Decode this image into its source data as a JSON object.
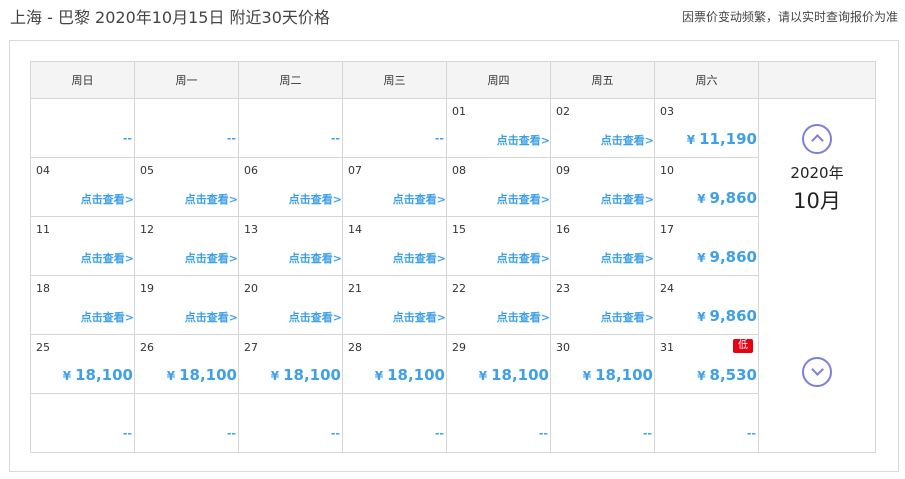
{
  "header": {
    "title": "上海 - 巴黎 2020年10月15日  附近30天价格",
    "notice": "因票价变动频繁，请以实时查询报价为准"
  },
  "weekdays": [
    "周日",
    "周一",
    "周二",
    "周三",
    "周四",
    "周五",
    "周六"
  ],
  "month_nav": {
    "year": "2020年",
    "month": "10月"
  },
  "link_text": "点击查看>",
  "currency": "¥",
  "low_badge": "低",
  "weeks": [
    [
      {
        "empty": true
      },
      {
        "empty": true
      },
      {
        "empty": true
      },
      {
        "empty": true
      },
      {
        "day": "01",
        "type": "link"
      },
      {
        "day": "02",
        "type": "link"
      },
      {
        "day": "03",
        "type": "price",
        "price": "11,190"
      }
    ],
    [
      {
        "day": "04",
        "type": "link"
      },
      {
        "day": "05",
        "type": "link"
      },
      {
        "day": "06",
        "type": "link"
      },
      {
        "day": "07",
        "type": "link"
      },
      {
        "day": "08",
        "type": "link"
      },
      {
        "day": "09",
        "type": "link"
      },
      {
        "day": "10",
        "type": "price",
        "price": "9,860"
      }
    ],
    [
      {
        "day": "11",
        "type": "link"
      },
      {
        "day": "12",
        "type": "link"
      },
      {
        "day": "13",
        "type": "link"
      },
      {
        "day": "14",
        "type": "link"
      },
      {
        "day": "15",
        "type": "link"
      },
      {
        "day": "16",
        "type": "link"
      },
      {
        "day": "17",
        "type": "price",
        "price": "9,860"
      }
    ],
    [
      {
        "day": "18",
        "type": "link"
      },
      {
        "day": "19",
        "type": "link"
      },
      {
        "day": "20",
        "type": "link"
      },
      {
        "day": "21",
        "type": "link"
      },
      {
        "day": "22",
        "type": "link"
      },
      {
        "day": "23",
        "type": "link"
      },
      {
        "day": "24",
        "type": "price",
        "price": "9,860"
      }
    ],
    [
      {
        "day": "25",
        "type": "price",
        "price": "18,100"
      },
      {
        "day": "26",
        "type": "price",
        "price": "18,100"
      },
      {
        "day": "27",
        "type": "price",
        "price": "18,100"
      },
      {
        "day": "28",
        "type": "price",
        "price": "18,100"
      },
      {
        "day": "29",
        "type": "price",
        "price": "18,100"
      },
      {
        "day": "30",
        "type": "price",
        "price": "18,100"
      },
      {
        "day": "31",
        "type": "price",
        "price": "8,530",
        "low": true
      }
    ],
    [
      {
        "empty": true
      },
      {
        "empty": true
      },
      {
        "empty": true
      },
      {
        "empty": true
      },
      {
        "empty": true
      },
      {
        "empty": true
      },
      {
        "empty": true
      }
    ]
  ],
  "empty_marker": "--"
}
